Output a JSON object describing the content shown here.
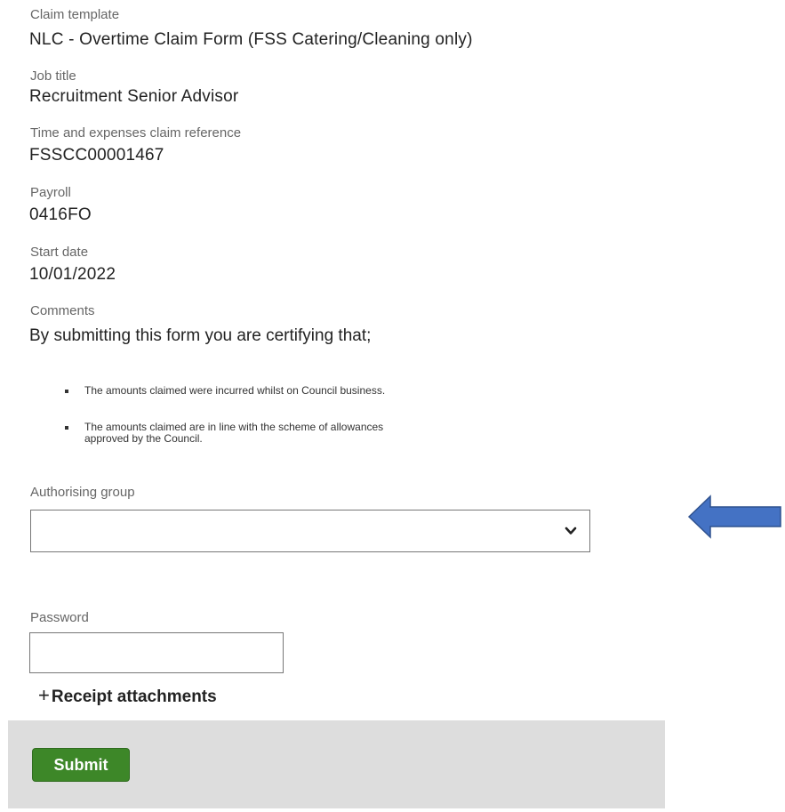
{
  "fields": [
    {
      "label": "Claim template",
      "value": "NLC - Overtime Claim Form (FSS Catering/Cleaning only)"
    },
    {
      "label": "Job title",
      "value": "Recruitment Senior Advisor"
    },
    {
      "label": "Time and expenses claim reference",
      "value": "FSSCC00001467"
    },
    {
      "label": "Payroll",
      "value": "0416FO"
    },
    {
      "label": "Start date",
      "value": "10/01/2022"
    }
  ],
  "comments": {
    "label": "Comments",
    "heading": "By submitting this form you are certifying that;",
    "bullets": [
      {
        "line1": "The amounts claimed were incurred whilst on Council business.",
        "line2": ""
      },
      {
        "line1": "The amounts claimed are in line with the scheme of allowances",
        "line2": "approved by the Council."
      }
    ]
  },
  "authorising_group": {
    "label": "Authorising group",
    "value": ""
  },
  "password": {
    "label": "Password",
    "value": ""
  },
  "receipt": {
    "plus": "+",
    "label": "Receipt attachments"
  },
  "submit_label": "Submit",
  "colors": {
    "submit": "#3d8728",
    "arrow": "#4472c4",
    "footer": "#dddddd"
  },
  "icons": {
    "dropdown": "chevron-down-icon",
    "annotation": "left-arrow-icon"
  }
}
